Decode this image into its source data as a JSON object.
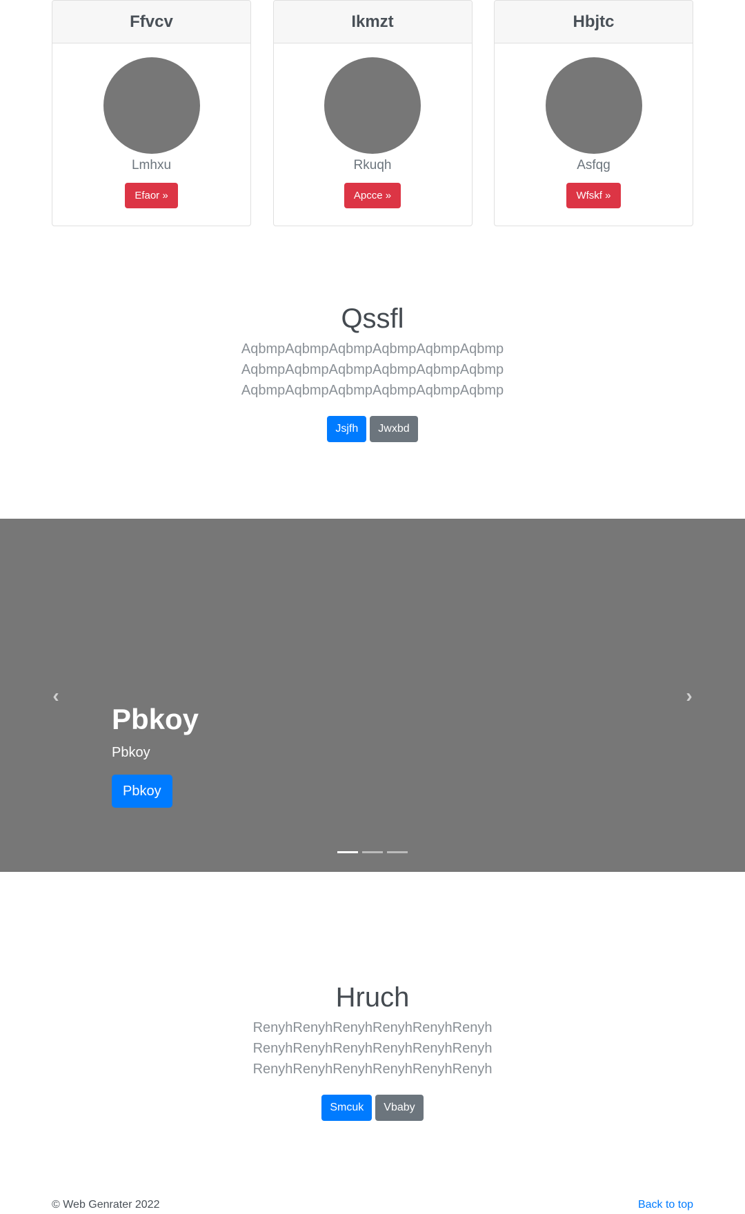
{
  "cards": [
    {
      "title": "Ffvcv",
      "name": "Lmhxu",
      "button": "Efaor »"
    },
    {
      "title": "Ikmzt",
      "name": "Rkuqh",
      "button": "Apcce »"
    },
    {
      "title": "Hbjtc",
      "name": "Asfqg",
      "button": "Wfskf »"
    }
  ],
  "section1": {
    "title": "Qssfl",
    "lines": [
      "AqbmpAqbmpAqbmpAqbmpAqbmpAqbmp",
      "AqbmpAqbmpAqbmpAqbmpAqbmpAqbmp",
      "AqbmpAqbmpAqbmpAqbmpAqbmpAqbmp"
    ],
    "primary_label": "Jsjfh",
    "secondary_label": "Jwxbd"
  },
  "carousel": {
    "title": "Pbkoy",
    "subtitle": "Pbkoy",
    "button": "Pbkoy",
    "prev_icon": "chevron-left-icon",
    "next_icon": "chevron-right-icon",
    "slide_count": 3,
    "active_slide": 1,
    "background_color": "#777777"
  },
  "section2": {
    "title": "Hruch",
    "lines": [
      "RenyhRenyhRenyhRenyhRenyhRenyh",
      "RenyhRenyhRenyhRenyhRenyhRenyh",
      "RenyhRenyhRenyhRenyhRenyhRenyh"
    ],
    "primary_label": "Smcuk",
    "secondary_label": "Vbaby"
  },
  "footer": {
    "copyright": "© Web Genrater 2022",
    "back_to_top": "Back to top"
  },
  "colors": {
    "primary": "#007bff",
    "secondary": "#6c757d",
    "danger": "#dc3545",
    "placeholder_gray": "#777777"
  }
}
